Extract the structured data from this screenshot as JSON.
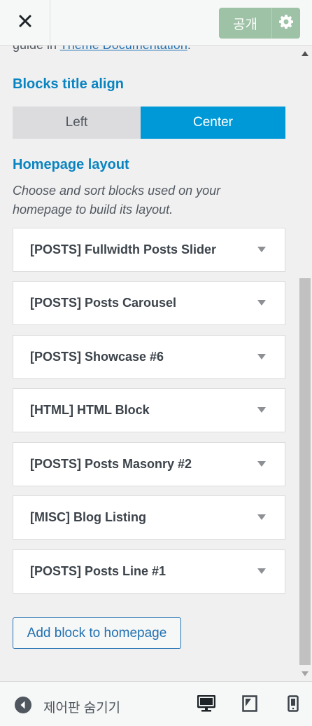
{
  "header": {
    "publish_label": "공개"
  },
  "content": {
    "guide_prefix": "guide in ",
    "guide_link": "Theme Documentation",
    "guide_suffix": ".",
    "blocks_title_align": {
      "title": "Blocks title align",
      "left_label": "Left",
      "center_label": "Center",
      "selected": "Center"
    },
    "homepage_layout": {
      "title": "Homepage layout",
      "description": "Choose and sort blocks used on your homepage to build its layout.",
      "blocks": [
        {
          "label": "[POSTS] Fullwidth Posts Slider"
        },
        {
          "label": "[POSTS] Posts Carousel"
        },
        {
          "label": "[POSTS] Showcase #6"
        },
        {
          "label": "[HTML] HTML Block"
        },
        {
          "label": "[POSTS] Posts Masonry #2"
        },
        {
          "label": "[MISC] Blog Listing"
        },
        {
          "label": "[POSTS] Posts Line #1"
        }
      ],
      "add_button": "Add block to homepage"
    }
  },
  "footer": {
    "collapse_label": "제어판 숨기기"
  },
  "icons": {
    "close": "close-icon",
    "settings": "gear-icon",
    "collapse": "collapse-icon",
    "desktop": "desktop-icon",
    "tablet": "tablet-icon",
    "mobile": "mobile-icon"
  },
  "colors": {
    "accent": "#0a84c0",
    "selected_button": "#0099d8",
    "publish_button": "#9ec2a5",
    "link": "#2271b1"
  }
}
